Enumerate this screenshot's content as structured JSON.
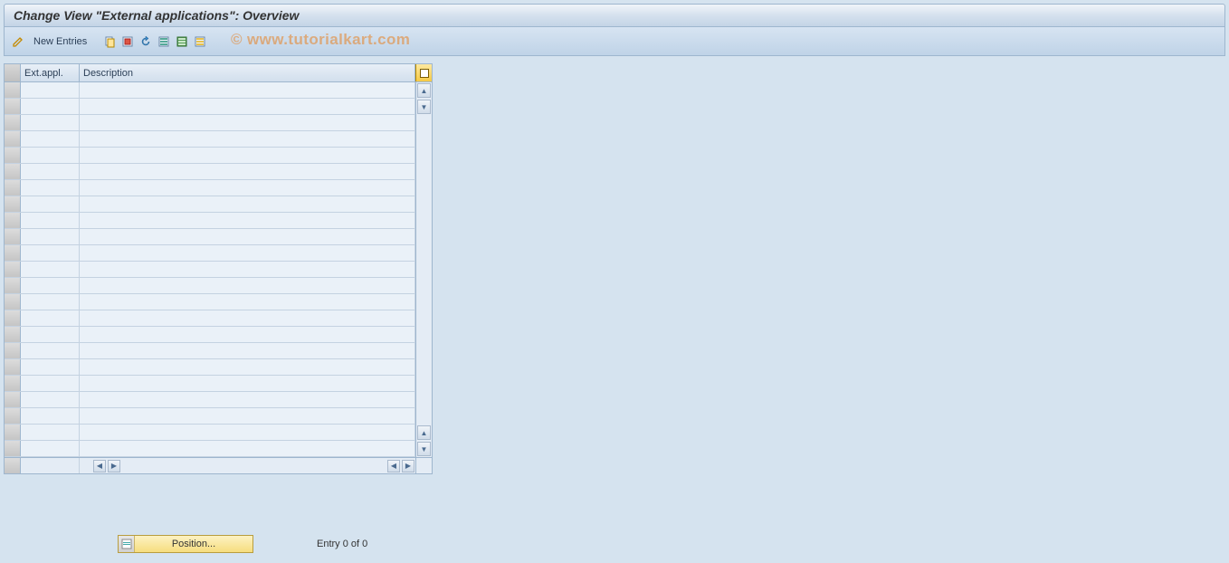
{
  "title": "Change View \"External applications\": Overview",
  "toolbar": {
    "new_entries_label": "New Entries"
  },
  "table": {
    "columns": {
      "ext_appl": "Ext.appl.",
      "description": "Description"
    },
    "rows": []
  },
  "footer": {
    "position_label": "Position...",
    "entry_status": "Entry 0 of 0"
  },
  "watermark": "© www.tutorialkart.com"
}
